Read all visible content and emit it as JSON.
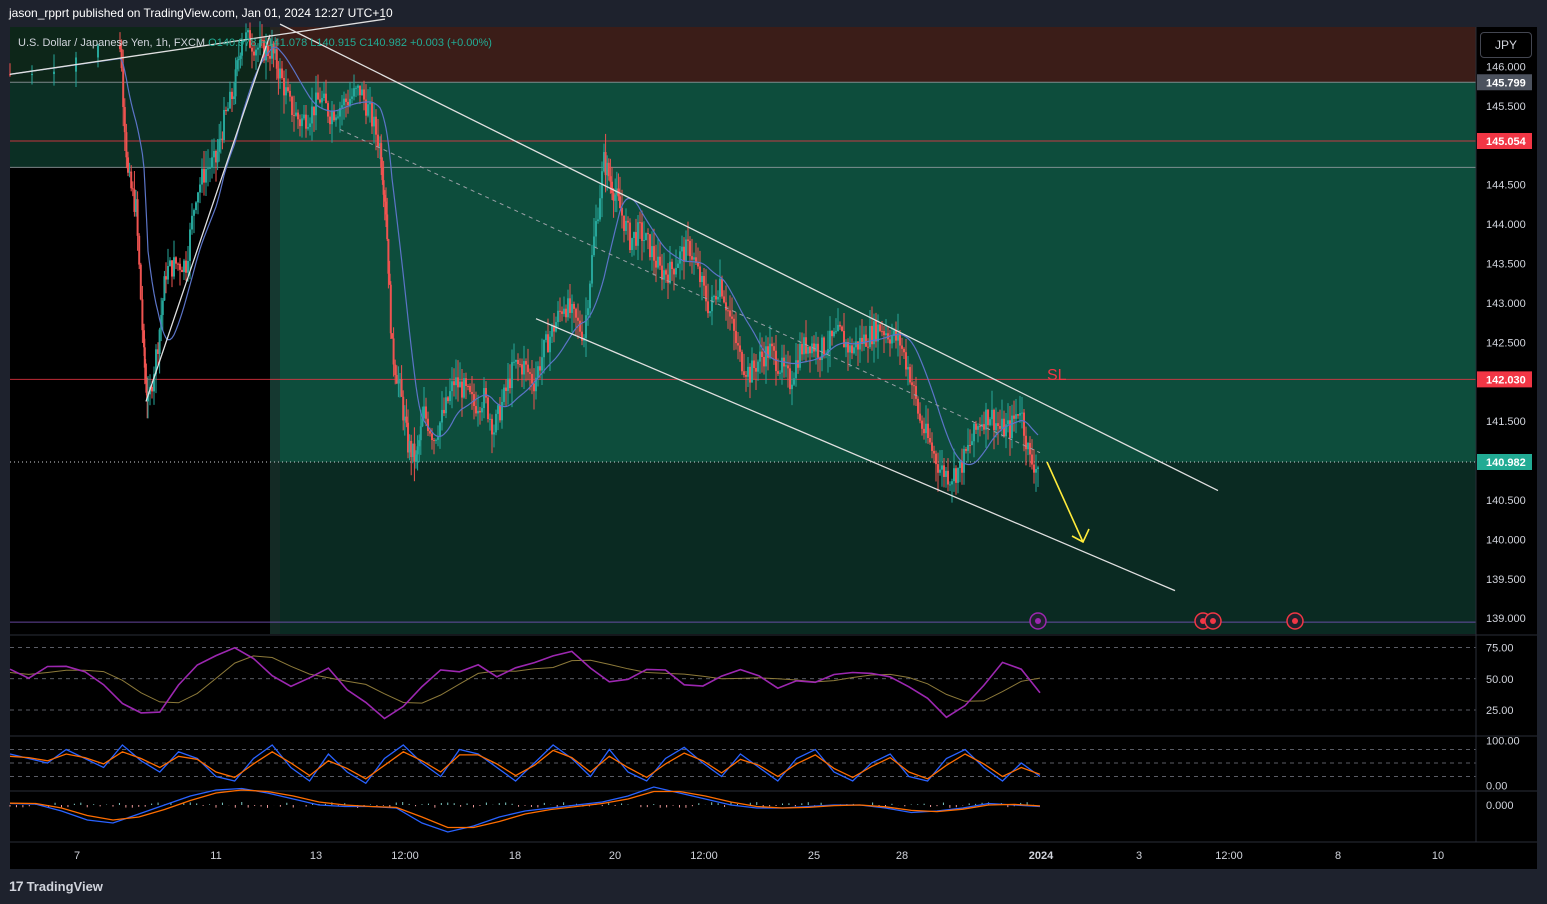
{
  "header": {
    "published": "jason_rpprt published on TradingView.com, Jan 01, 2024 12:27 UTC+10"
  },
  "symbol_line": {
    "name": "U.S. Dollar / Japanese Yen, 1h, FXCM",
    "open": "O140.978",
    "high": "H141.078",
    "low": "L140.915",
    "close": "C140.982",
    "change": "+0.003 (+0.00%)"
  },
  "currency": "JPY",
  "footer": {
    "brand": "TradingView",
    "logo": "17"
  },
  "annotations": {
    "sl_label": "SL"
  },
  "colors": {
    "background": "#000000",
    "up_candle": "#26a69a",
    "down_candle": "#ef5350",
    "ma": "#5b74c7",
    "rsi": "#9c27b0",
    "rsi_signal": "#8d7a3a",
    "stoch_k": "#2962ff",
    "stoch_d": "#ff6d00",
    "arrow": "#ffeb3b",
    "zone_top": "#3b1d18",
    "zone_green": "#0d4d3c",
    "zone_dark": "#0a2a22",
    "price_red": "#f23645",
    "price_green": "#22ab94",
    "price_gray": "#4c525e"
  },
  "chart_data": [
    {
      "type": "candlestick",
      "title": "U.S. Dollar / Japanese Yen, 1h, FXCM",
      "ylim": [
        138.8,
        146.5
      ],
      "y_ticks": [
        "146.000",
        "145.500",
        "145.000",
        "144.500",
        "144.000",
        "143.500",
        "143.000",
        "142.500",
        "142.000",
        "141.500",
        "141.000",
        "140.500",
        "140.000",
        "139.500",
        "139.000"
      ],
      "x_ticks": [
        "7",
        "11",
        "13",
        "12:00",
        "18",
        "20",
        "12:00",
        "25",
        "28",
        "2024",
        "3",
        "12:00",
        "8",
        "10"
      ],
      "price_labels": [
        {
          "value": "145.799",
          "style": "gray"
        },
        {
          "value": "145.054",
          "style": "red"
        },
        {
          "value": "142.030",
          "style": "red"
        },
        {
          "value": "140.982",
          "style": "green"
        }
      ],
      "horizontal_levels": [
        145.799,
        145.054,
        144.72,
        142.03,
        140.982,
        138.95
      ],
      "trend_channel": {
        "upper": [
          [
            140.0,
            146.6
          ],
          [
            1208,
            140.62
          ]
        ],
        "lower": [
          [
            526,
            142.8
          ],
          [
            1165,
            139.35
          ]
        ]
      },
      "price_path": [
        [
          0,
          145.9
        ],
        [
          110,
          146.3
        ],
        [
          118,
          144.6
        ],
        [
          126,
          144.2
        ],
        [
          134,
          142.3
        ],
        [
          138,
          141.7
        ],
        [
          148,
          142.5
        ],
        [
          156,
          143.4
        ],
        [
          166,
          143.5
        ],
        [
          176,
          143.5
        ],
        [
          186,
          144.4
        ],
        [
          196,
          144.7
        ],
        [
          206,
          144.8
        ],
        [
          214,
          145.3
        ],
        [
          224,
          145.7
        ],
        [
          232,
          146.4
        ],
        [
          242,
          146.3
        ],
        [
          252,
          146.2
        ],
        [
          262,
          146.2
        ],
        [
          270,
          145.9
        ],
        [
          280,
          145.5
        ],
        [
          290,
          145.3
        ],
        [
          300,
          145.4
        ],
        [
          310,
          145.6
        ],
        [
          320,
          145.4
        ],
        [
          330,
          145.5
        ],
        [
          340,
          145.6
        ],
        [
          350,
          145.7
        ],
        [
          360,
          145.4
        ],
        [
          370,
          145.0
        ],
        [
          376,
          144.2
        ],
        [
          382,
          142.4
        ],
        [
          390,
          141.9
        ],
        [
          398,
          141.2
        ],
        [
          406,
          141.0
        ],
        [
          414,
          141.6
        ],
        [
          424,
          141.3
        ],
        [
          434,
          141.6
        ],
        [
          444,
          142.0
        ],
        [
          454,
          141.9
        ],
        [
          464,
          141.7
        ],
        [
          474,
          141.8
        ],
        [
          484,
          141.4
        ],
        [
          494,
          141.8
        ],
        [
          504,
          142.2
        ],
        [
          514,
          142.2
        ],
        [
          524,
          142.0
        ],
        [
          534,
          142.4
        ],
        [
          544,
          142.7
        ],
        [
          554,
          143.0
        ],
        [
          564,
          142.8
        ],
        [
          574,
          142.6
        ],
        [
          584,
          143.8
        ],
        [
          594,
          144.8
        ],
        [
          602,
          144.5
        ],
        [
          610,
          144.2
        ],
        [
          620,
          143.8
        ],
        [
          630,
          143.9
        ],
        [
          640,
          143.7
        ],
        [
          650,
          143.4
        ],
        [
          660,
          143.4
        ],
        [
          670,
          143.6
        ],
        [
          680,
          143.7
        ],
        [
          690,
          143.3
        ],
        [
          700,
          142.9
        ],
        [
          710,
          143.3
        ],
        [
          720,
          142.8
        ],
        [
          730,
          142.3
        ],
        [
          740,
          142.1
        ],
        [
          750,
          142.3
        ],
        [
          760,
          142.4
        ],
        [
          770,
          142.2
        ],
        [
          780,
          142.0
        ],
        [
          790,
          142.4
        ],
        [
          800,
          142.5
        ],
        [
          810,
          142.4
        ],
        [
          820,
          142.5
        ],
        [
          830,
          142.6
        ],
        [
          840,
          142.4
        ],
        [
          850,
          142.5
        ],
        [
          860,
          142.6
        ],
        [
          870,
          142.7
        ],
        [
          880,
          142.6
        ],
        [
          890,
          142.5
        ],
        [
          900,
          142.1
        ],
        [
          910,
          141.5
        ],
        [
          920,
          141.2
        ],
        [
          930,
          140.9
        ],
        [
          940,
          140.8
        ],
        [
          950,
          140.9
        ],
        [
          960,
          141.2
        ],
        [
          970,
          141.5
        ],
        [
          980,
          141.6
        ],
        [
          990,
          141.4
        ],
        [
          1000,
          141.4
        ],
        [
          1010,
          141.7
        ],
        [
          1020,
          141.0
        ],
        [
          1030,
          140.9
        ]
      ]
    },
    {
      "type": "line",
      "title": "RSI",
      "ylim": [
        5,
        85
      ],
      "y_ticks": [
        "75.00",
        "50.00",
        "25.00"
      ],
      "series": [
        {
          "values": [
            55,
            52,
            58,
            62,
            55,
            48,
            30,
            22,
            26,
            45,
            60,
            70,
            75,
            68,
            55,
            42,
            50,
            56,
            44,
            32,
            20,
            28,
            42,
            58,
            55,
            62,
            50,
            57,
            63,
            66,
            72,
            58,
            50,
            52,
            60,
            55,
            48,
            45,
            52,
            56,
            50,
            42,
            48,
            50,
            54,
            52,
            56,
            52,
            44,
            32,
            22,
            30,
            45,
            62,
            55,
            40
          ]
        }
      ]
    },
    {
      "type": "line",
      "title": "Stochastic",
      "ylim": [
        -10,
        110
      ],
      "y_ticks": [
        "100.00",
        "0.00"
      ],
      "series": [
        {
          "values": [
            70,
            60,
            50,
            80,
            60,
            40,
            90,
            55,
            30,
            75,
            60,
            20,
            10,
            60,
            90,
            40,
            10,
            70,
            30,
            5,
            60,
            90,
            50,
            20,
            80,
            70,
            40,
            10,
            50,
            90,
            60,
            20,
            80,
            30,
            10,
            60,
            85,
            50,
            20,
            70,
            40,
            10,
            60,
            80,
            30,
            10,
            50,
            70,
            20,
            10,
            60,
            80,
            40,
            10,
            50,
            20
          ]
        },
        {
          "values": [
            65,
            62,
            55,
            70,
            62,
            48,
            75,
            60,
            40,
            65,
            58,
            30,
            18,
            48,
            75,
            50,
            22,
            55,
            38,
            15,
            45,
            75,
            55,
            30,
            68,
            68,
            48,
            22,
            45,
            78,
            62,
            30,
            65,
            40,
            18,
            48,
            72,
            55,
            28,
            58,
            45,
            20,
            48,
            68,
            38,
            18,
            42,
            62,
            30,
            15,
            45,
            70,
            48,
            20,
            40,
            25
          ]
        }
      ]
    },
    {
      "type": "line",
      "title": "MACD",
      "y_ticks": [
        "0.000"
      ],
      "series": [
        {
          "values": [
            0.05,
            0.03,
            -0.2,
            -0.5,
            -0.6,
            -0.3,
            0.0,
            0.3,
            0.5,
            0.55,
            0.4,
            0.2,
            0.0,
            -0.05,
            -0.05,
            -0.1,
            -0.6,
            -0.9,
            -0.7,
            -0.4,
            -0.2,
            -0.1,
            0.0,
            0.1,
            0.3,
            0.6,
            0.4,
            0.2,
            0.0,
            -0.1,
            -0.1,
            -0.05,
            0.0,
            0.0,
            -0.1,
            -0.25,
            -0.2,
            -0.1,
            0.05,
            0.0,
            -0.05
          ]
        },
        {
          "values": [
            0.06,
            0.05,
            -0.1,
            -0.35,
            -0.5,
            -0.4,
            -0.15,
            0.15,
            0.4,
            0.5,
            0.45,
            0.3,
            0.1,
            0.0,
            -0.05,
            -0.08,
            -0.4,
            -0.75,
            -0.75,
            -0.55,
            -0.3,
            -0.15,
            -0.05,
            0.05,
            0.2,
            0.45,
            0.45,
            0.3,
            0.1,
            -0.05,
            -0.1,
            -0.08,
            -0.02,
            0.0,
            -0.06,
            -0.18,
            -0.22,
            -0.14,
            0.0,
            0.02,
            -0.03
          ]
        }
      ]
    }
  ]
}
